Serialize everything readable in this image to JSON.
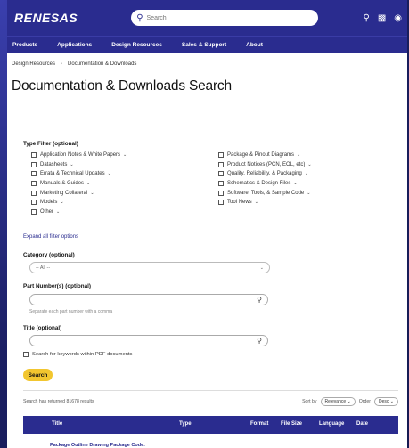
{
  "header": {
    "logo": "RENESAS",
    "search_placeholder": "Search",
    "icons": [
      "cart-icon",
      "calendar-icon",
      "globe-icon"
    ]
  },
  "nav": {
    "items": [
      "Products",
      "Applications",
      "Design Resources",
      "Sales & Support",
      "About"
    ]
  },
  "breadcrumb": [
    "Design Resources",
    "Documentation & Downloads"
  ],
  "page_title": "Documentation & Downloads Search",
  "type_filter": {
    "label": "Type Filter (optional)",
    "left": [
      "Application Notes & White Papers",
      "Datasheets",
      "Errata & Technical Updates",
      "Manuals & Guides",
      "Marketing Collateral",
      "Models",
      "Other"
    ],
    "right": [
      "Package & Pinout Diagrams",
      "Product Notices (PCN, EOL, etc)",
      "Quality, Reliability, & Packaging",
      "Schematics & Design Files",
      "Software, Tools, & Sample Code",
      "Tool News"
    ],
    "expand_link": "Expand all filter options"
  },
  "category": {
    "label": "Category (optional)",
    "value": "-- All --"
  },
  "part_numbers": {
    "label": "Part Number(s) (optional)",
    "hint": "Separate each part number with a comma"
  },
  "title_field": {
    "label": "Title (optional)"
  },
  "keyword_checkbox": "Search for keywords within PDF documents",
  "search_button": "Search",
  "results": {
    "summary": "Search has returned 81678 results",
    "sort_label": "Sort by",
    "sort_value": "Relevance",
    "order_label": "Order",
    "order_value": "Desc"
  },
  "table": {
    "headers": [
      "Title",
      "Type",
      "Format",
      "File Size",
      "Language",
      "Date"
    ],
    "first_row_title": "Package Outline Drawing Package Code:"
  },
  "colors": {
    "brand": "#2a2c8f",
    "accent": "#f2c62f"
  }
}
